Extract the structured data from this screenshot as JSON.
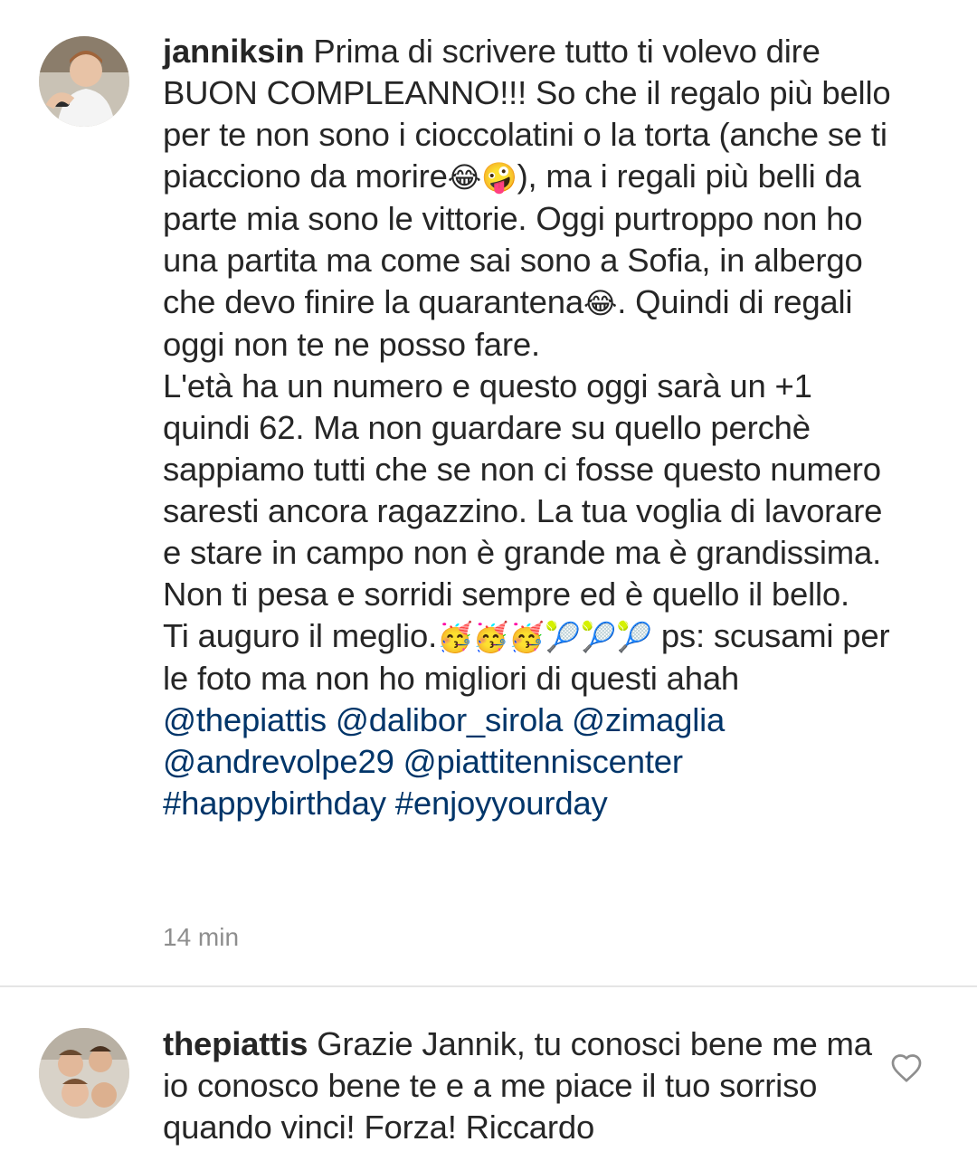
{
  "comments": [
    {
      "username": "janniksin",
      "text_1": " Prima di scrivere tutto ti volevo dire BUON COMPLEANNO!!! So che il regalo più bello per te non sono i cioccolatini o la torta (anche se ti piacciono da morire",
      "emoji_1": "😂",
      "emoji_2": "🤪",
      "text_2": "), ma i regali più belli da parte mia sono le vittorie. Oggi purtroppo non ho una partita ma come sai sono a Sofia, in albergo che devo finire la quarantena",
      "emoji_3": "😂",
      "text_3": ". Quindi di regali oggi non te ne posso fare.",
      "text_4": "L'età ha un numero e questo oggi sarà un +1 quindi 62. Ma non guardare su quello perchè sappiamo tutti che se non ci fosse questo numero saresti ancora ragazzino. La tua voglia di lavorare e stare in campo non è grande ma è grandissima. Non ti pesa e sorridi sempre ed è quello il bello.",
      "text_5": "Ti auguro il meglio.",
      "emoji_party": "🥳🥳🥳",
      "emoji_tennis": "🎾🎾🎾",
      "text_6": " ps: scusami per le foto ma non ho migliori di questi ahah ",
      "mentions": [
        "@thepiattis",
        "@dalibor_sirola",
        "@zimaglia",
        "@andrevolpe29",
        "@piattitenniscenter"
      ],
      "hashtags": [
        "#happybirthday",
        "#enjoyyourday"
      ],
      "timestamp": "14 min",
      "avatar_icon": "profile-photo-tennis-player"
    },
    {
      "username": "thepiattis",
      "text": " Grazie Jannik, tu conosci bene me ma io conosco bene te e a me piace il tuo sorriso quando vinci! Forza! Riccardo",
      "avatar_icon": "profile-photo-group",
      "like_icon": "heart-outline-icon"
    }
  ],
  "colors": {
    "text": "#262626",
    "link": "#003569",
    "muted": "#8e8e8e",
    "divider": "#e5e5e5"
  }
}
